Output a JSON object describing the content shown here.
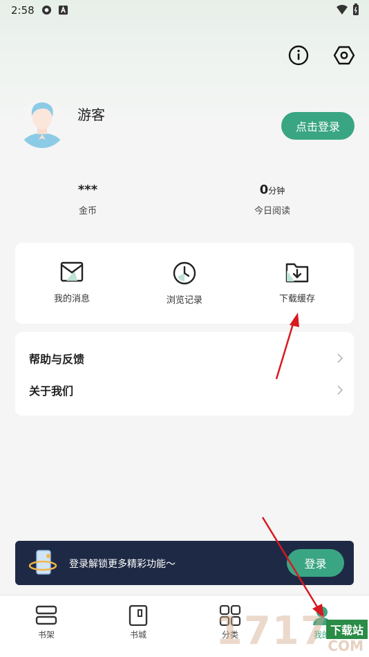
{
  "status_bar": {
    "time": "2:58"
  },
  "profile": {
    "nickname": "游客",
    "login_button": "点击登录"
  },
  "stats": [
    {
      "value": "***",
      "unit": "",
      "label": "金币"
    },
    {
      "value": "0",
      "unit": "分钟",
      "label": "今日阅读"
    }
  ],
  "quick_actions": [
    {
      "label": "我的消息",
      "icon": "message-icon"
    },
    {
      "label": "浏览记录",
      "icon": "clock-icon"
    },
    {
      "label": "下载缓存",
      "icon": "download-folder-icon"
    }
  ],
  "menu": [
    {
      "label": "帮助与反馈"
    },
    {
      "label": "关于我们"
    }
  ],
  "banner": {
    "text": "登录解锁更多精彩功能～",
    "button": "登录"
  },
  "tabs": [
    {
      "label": "书架",
      "icon": "bookshelf-icon"
    },
    {
      "label": "书城",
      "icon": "bookstore-icon"
    },
    {
      "label": "分类",
      "icon": "category-icon"
    },
    {
      "label": "我的",
      "icon": "profile-icon",
      "active": true
    }
  ],
  "watermark": {
    "digits": "1717",
    "tag": "下载站",
    "domain": "COM"
  },
  "colors": {
    "accent": "#3aa582",
    "banner_bg": "#1e2a45",
    "annotation_arrow": "#d71920"
  }
}
